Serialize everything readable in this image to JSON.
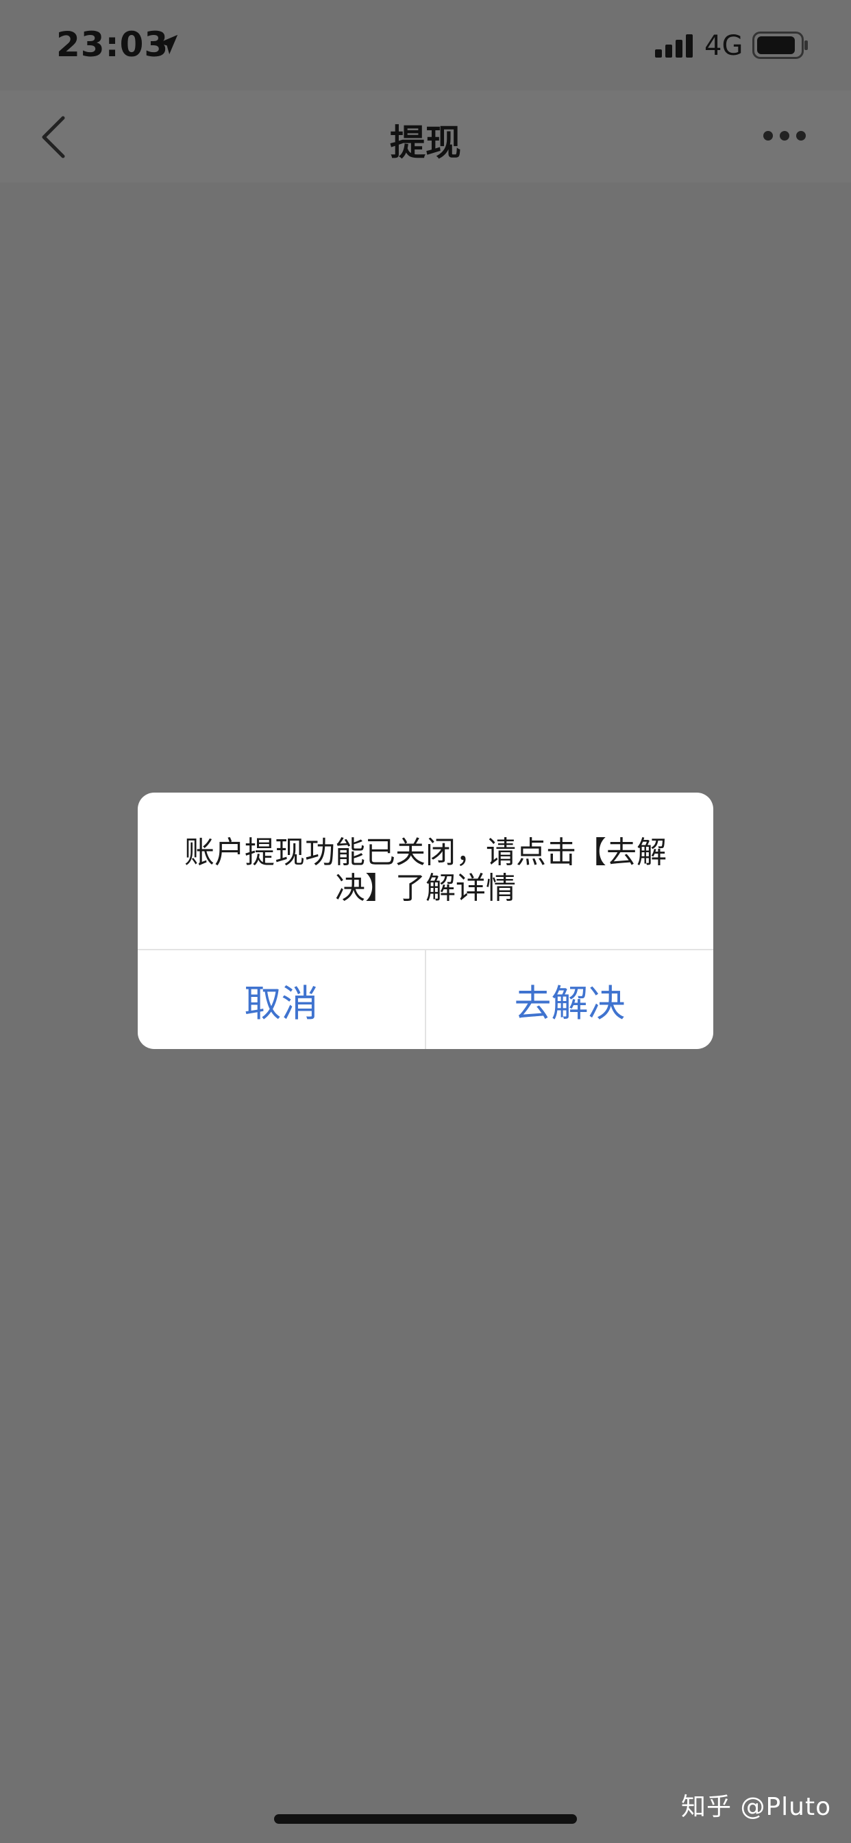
{
  "status_bar": {
    "time": "23:03",
    "network": "4G",
    "icons": [
      "location-arrow-icon",
      "signal-bars-icon",
      "battery-icon"
    ]
  },
  "nav": {
    "title": "提现",
    "icons": [
      "back-chevron-icon",
      "more-dots-icon"
    ]
  },
  "dialog": {
    "message": "账户提现功能已关闭，请点击【去解决】了解详情",
    "cancel_label": "取消",
    "resolve_label": "去解决"
  },
  "watermark": "知乎 @Pluto",
  "colors": {
    "overlay_bg": "#717171",
    "accent": "#3f73cf",
    "dialog_bg": "#ffffff"
  }
}
